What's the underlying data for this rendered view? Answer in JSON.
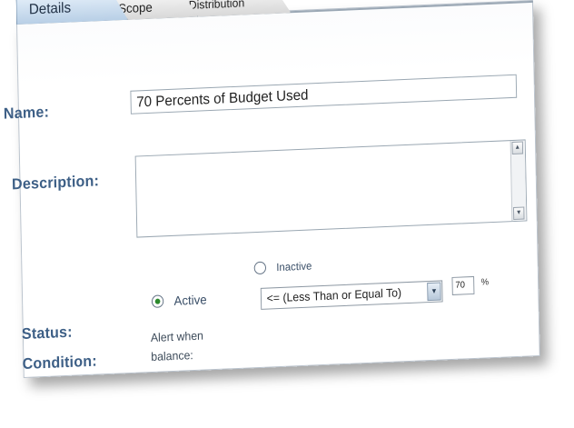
{
  "tabs": [
    {
      "label": "Details",
      "active": true
    },
    {
      "label": "Scope",
      "active": false
    },
    {
      "label": "Distribution",
      "active": false
    }
  ],
  "form": {
    "name_label": "Name:",
    "name_value": "70 Percents of Budget Used",
    "description_label": "Description:",
    "description_value": "",
    "status_label": "Status:",
    "status_options": [
      {
        "label": "Active",
        "selected": true
      },
      {
        "label": "Inactive",
        "selected": false
      }
    ],
    "condition_label": "Condition:",
    "alert_line1": "Alert when",
    "alert_line2": "balance:",
    "condition_selected": "<= (Less Than or Equal To)",
    "percent_value": "70",
    "percent_unit": "%"
  },
  "colors": {
    "label": "#3d5f86",
    "active_tab": "#b8cfe6",
    "radio_selected": "#2c8a2c"
  }
}
